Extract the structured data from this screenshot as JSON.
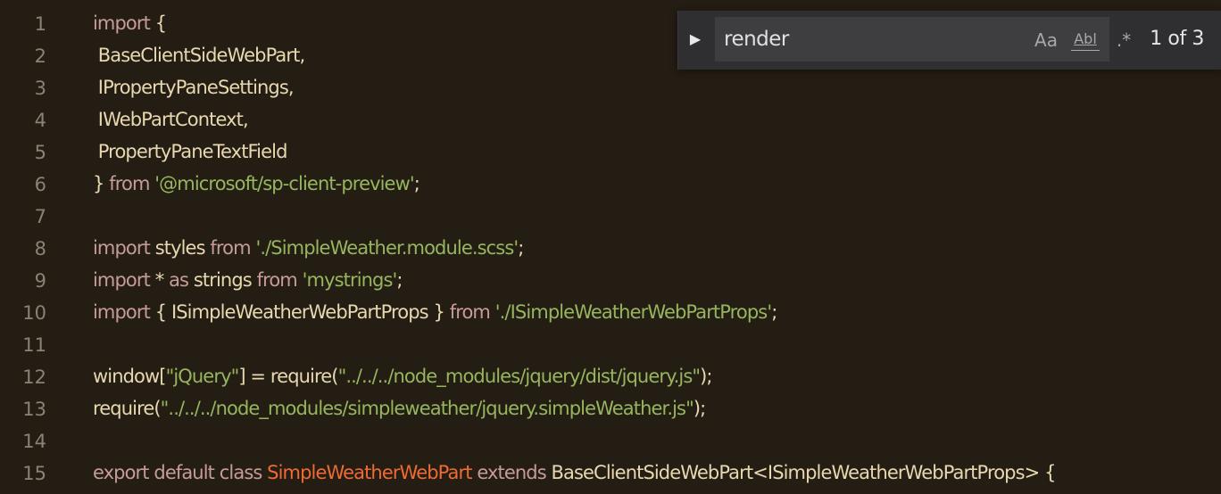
{
  "editor": {
    "lines": [
      {
        "number": "1",
        "tokens": [
          {
            "t": "import",
            "k": "kw"
          },
          {
            "t": " {",
            "k": "punc"
          }
        ]
      },
      {
        "number": "2",
        "tokens": [
          {
            "t": " BaseClientSideWebPart,",
            "k": "id"
          }
        ]
      },
      {
        "number": "3",
        "tokens": [
          {
            "t": " IPropertyPaneSettings,",
            "k": "id"
          }
        ]
      },
      {
        "number": "4",
        "tokens": [
          {
            "t": " IWebPartContext,",
            "k": "id"
          }
        ]
      },
      {
        "number": "5",
        "tokens": [
          {
            "t": " PropertyPaneTextField",
            "k": "id"
          }
        ]
      },
      {
        "number": "6",
        "tokens": [
          {
            "t": "} ",
            "k": "punc"
          },
          {
            "t": "from",
            "k": "kw"
          },
          {
            "t": " '@microsoft/sp-client-preview'",
            "k": "str"
          },
          {
            "t": ";",
            "k": "punc"
          }
        ]
      },
      {
        "number": "7",
        "tokens": []
      },
      {
        "number": "8",
        "tokens": [
          {
            "t": "import",
            "k": "kw"
          },
          {
            "t": " styles ",
            "k": "id"
          },
          {
            "t": "from",
            "k": "kw"
          },
          {
            "t": " './SimpleWeather.module.scss'",
            "k": "str"
          },
          {
            "t": ";",
            "k": "punc"
          }
        ]
      },
      {
        "number": "9",
        "tokens": [
          {
            "t": "import",
            "k": "kw"
          },
          {
            "t": " * ",
            "k": "id"
          },
          {
            "t": "as",
            "k": "kw"
          },
          {
            "t": " strings ",
            "k": "id"
          },
          {
            "t": "from",
            "k": "kw"
          },
          {
            "t": " 'mystrings'",
            "k": "str"
          },
          {
            "t": ";",
            "k": "punc"
          }
        ]
      },
      {
        "number": "10",
        "tokens": [
          {
            "t": "import",
            "k": "kw"
          },
          {
            "t": " { ISimpleWeatherWebPartProps } ",
            "k": "id"
          },
          {
            "t": "from",
            "k": "kw"
          },
          {
            "t": " './ISimpleWeatherWebPartProps'",
            "k": "str"
          },
          {
            "t": ";",
            "k": "punc"
          }
        ]
      },
      {
        "number": "11",
        "tokens": []
      },
      {
        "number": "12",
        "tokens": [
          {
            "t": "window[",
            "k": "id"
          },
          {
            "t": "\"jQuery\"",
            "k": "str"
          },
          {
            "t": "] = require(",
            "k": "id"
          },
          {
            "t": "\"../../../node_modules/jquery/dist/jquery.js\"",
            "k": "str"
          },
          {
            "t": ");",
            "k": "punc"
          }
        ]
      },
      {
        "number": "13",
        "tokens": [
          {
            "t": "require(",
            "k": "id"
          },
          {
            "t": "\"../../../node_modules/simpleweather/jquery.simpleWeather.js\"",
            "k": "str"
          },
          {
            "t": ");",
            "k": "punc"
          }
        ]
      },
      {
        "number": "14",
        "tokens": []
      },
      {
        "number": "15",
        "tokens": [
          {
            "t": "export default class ",
            "k": "kw"
          },
          {
            "t": "SimpleWeatherWebPart",
            "k": "cls"
          },
          {
            "t": " extends ",
            "k": "kw"
          },
          {
            "t": "BaseClientSideWebPart<ISimpleWeatherWebPartProps> {",
            "k": "id"
          }
        ]
      }
    ]
  },
  "find_widget": {
    "toggle_icon": "chevron-right-icon",
    "query": "render",
    "match_case_label": "Aa",
    "whole_word_label": "Abl",
    "regex_label": ".*",
    "match_count": "1 of 3"
  },
  "colors": {
    "background": "#241d14",
    "line_number": "#8a8273",
    "keyword": "#c79b98",
    "identifier": "#e8d8b0",
    "string": "#96b65e",
    "class_name": "#ef6b33",
    "widget_bg": "#2f2f31"
  }
}
